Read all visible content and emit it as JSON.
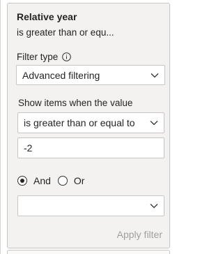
{
  "filter_card": {
    "title": "Relative year",
    "subtitle": "is greater than or equ...",
    "filter_type_label": "Filter type",
    "filter_type_value": "Advanced filtering",
    "show_items_label": "Show items when the value",
    "condition_value": "is greater than or equal to",
    "value_input": "-2",
    "logic": {
      "and_label": "And",
      "or_label": "Or",
      "selected": "And"
    },
    "second_condition_value": "",
    "apply_label": "Apply filter"
  },
  "icons": {
    "info": "info-icon",
    "dropdown": "chevron-down-icon"
  },
  "colors": {
    "card_bg": "#f3f2f1",
    "border": "#c8c6c4",
    "text": "#252423",
    "disabled_text": "#a19f9d"
  }
}
